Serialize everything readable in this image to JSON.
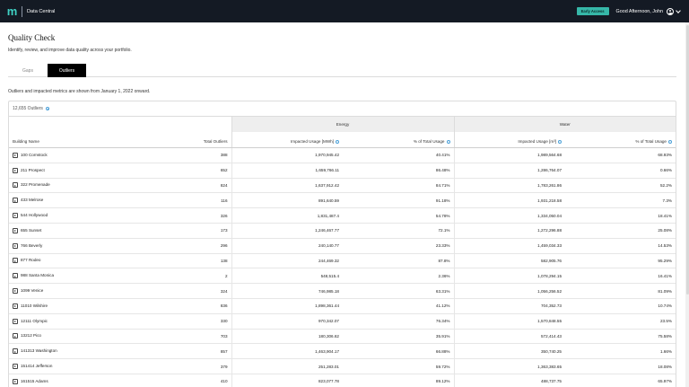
{
  "header": {
    "logo": "m",
    "app_name": "Data Central",
    "badge": "Early Access",
    "greeting": "Good Afternoon, John"
  },
  "page": {
    "title": "Quality Check",
    "subtitle": "Identify, review, and improve data quality across your portfolio."
  },
  "tabs": [
    {
      "label": "Gaps",
      "active": false
    },
    {
      "label": "Outliers",
      "active": true
    }
  ],
  "note": "Outliers and impacted metrics are shown from January 1, 2022 onward.",
  "summary": {
    "count_label": "12,655 Outliers"
  },
  "table": {
    "group_energy": "Energy",
    "group_water": "Water",
    "headers": {
      "building": "Building Name",
      "total_outliers": "Total Outliers",
      "energy_impacted": "Impacted Usage [MWh]",
      "energy_pct": "% of Total Usage",
      "water_impacted": "Impacted Usage [m³]",
      "water_pct": "% of Total Usage"
    },
    "rows": [
      {
        "name": "100 Cornstock",
        "outliers": "388",
        "e_usage": "1,970,945.42",
        "e_pct": "40.41%",
        "w_usage": "1,989,564.68",
        "w_pct": "68.93%"
      },
      {
        "name": "211 Prospect",
        "outliers": "652",
        "e_usage": "1,659,766.11",
        "e_pct": "86.48%",
        "w_usage": "1,286,764.07",
        "w_pct": "0.66%"
      },
      {
        "name": "322 Promenade",
        "outliers": "824",
        "e_usage": "1,637,912.42",
        "e_pct": "84.71%",
        "w_usage": "1,783,261.86",
        "w_pct": "52.2%"
      },
      {
        "name": "433 Melrose",
        "outliers": "116",
        "e_usage": "891,640.59",
        "e_pct": "91.18%",
        "w_usage": "1,931,218.58",
        "w_pct": "7.3%"
      },
      {
        "name": "544 Hollywood",
        "outliers": "326",
        "e_usage": "1,831,487.4",
        "e_pct": "54.78%",
        "w_usage": "1,334,050.04",
        "w_pct": "18.41%"
      },
      {
        "name": "655 Sunset",
        "outliers": "173",
        "e_usage": "1,246,467.77",
        "e_pct": "72.1%",
        "w_usage": "1,272,296.88",
        "w_pct": "25.08%"
      },
      {
        "name": "766 Beverly",
        "outliers": "296",
        "e_usage": "240,140.77",
        "e_pct": "23.33%",
        "w_usage": "1,459,034.33",
        "w_pct": "14.53%"
      },
      {
        "name": "877 Rodeo",
        "outliers": "138",
        "e_usage": "244,469.32",
        "e_pct": "87.8%",
        "w_usage": "582,905.76",
        "w_pct": "95.29%"
      },
      {
        "name": "988 Santa Monica",
        "outliers": "2",
        "e_usage": "548,515.4",
        "e_pct": "2.36%",
        "w_usage": "1,078,294.15",
        "w_pct": "16.41%"
      },
      {
        "name": "1099 Venice",
        "outliers": "324",
        "e_usage": "746,985.18",
        "e_pct": "63.31%",
        "w_usage": "1,056,256.52",
        "w_pct": "81.09%"
      },
      {
        "name": "11010 Wilshire",
        "outliers": "836",
        "e_usage": "1,898,361.44",
        "e_pct": "41.12%",
        "w_usage": "704,352.73",
        "w_pct": "10.74%"
      },
      {
        "name": "12111 Olympic",
        "outliers": "330",
        "e_usage": "970,342.07",
        "e_pct": "76.34%",
        "w_usage": "1,570,848.55",
        "w_pct": "23.5%"
      },
      {
        "name": "13212 Pico",
        "outliers": "703",
        "e_usage": "180,306.62",
        "e_pct": "35.91%",
        "w_usage": "572,414.43",
        "w_pct": "75.58%"
      },
      {
        "name": "141313 Washington",
        "outliers": "857",
        "e_usage": "1,463,904.17",
        "e_pct": "66.88%",
        "w_usage": "350,740.25",
        "w_pct": "1.66%"
      },
      {
        "name": "151414 Jefferson",
        "outliers": "379",
        "e_usage": "251,283.01",
        "e_pct": "59.72%",
        "w_usage": "1,363,383.65",
        "w_pct": "18.08%"
      },
      {
        "name": "161515 Adams",
        "outliers": "410",
        "e_usage": "823,077.78",
        "e_pct": "89.12%",
        "w_usage": "488,737.75",
        "w_pct": "65.97%"
      }
    ]
  }
}
